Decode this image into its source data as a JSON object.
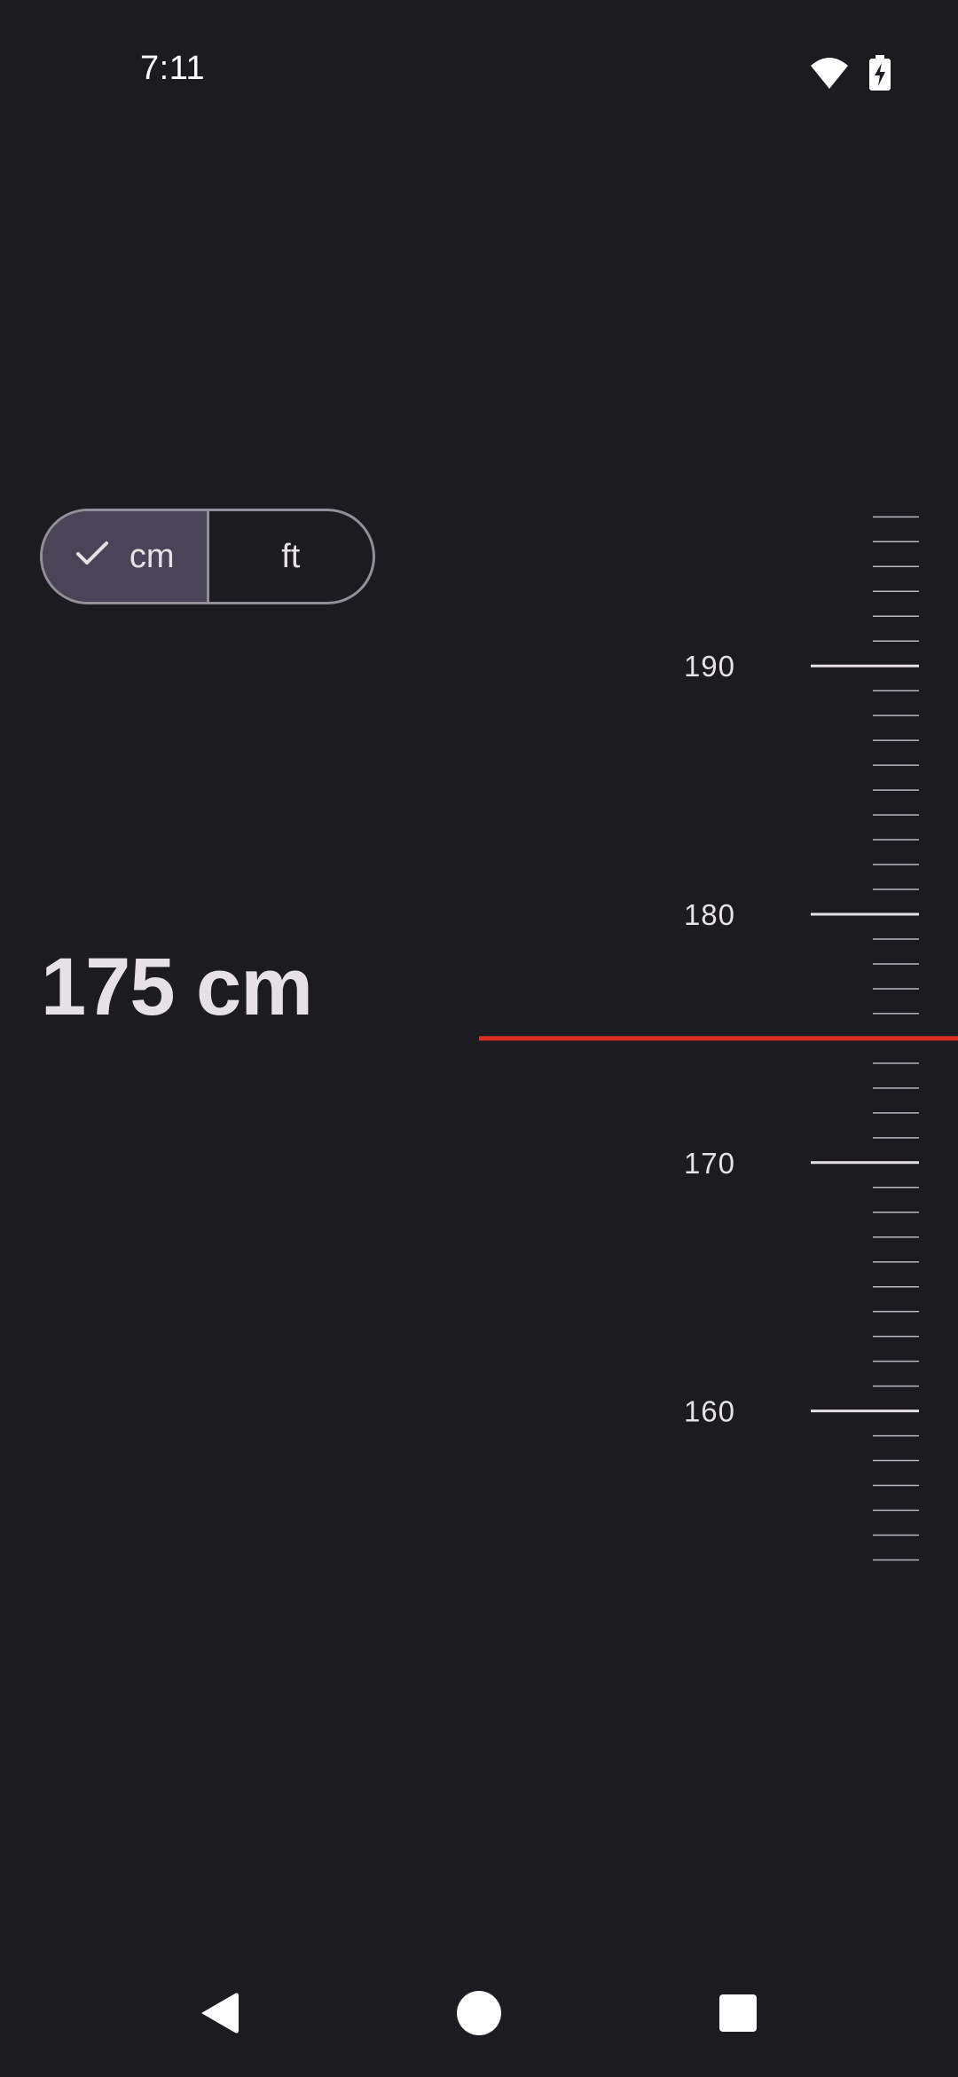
{
  "status_bar": {
    "time": "7:11",
    "icons": [
      "wifi-icon",
      "battery-charging-icon"
    ]
  },
  "unit_toggle": {
    "options": [
      {
        "label": "cm",
        "selected": true,
        "icon": "check-icon"
      },
      {
        "label": "ft",
        "selected": false
      }
    ]
  },
  "height_display": {
    "value": "175 cm"
  },
  "ruler": {
    "unit": "cm",
    "min": 154,
    "max": 196,
    "major_step": 10,
    "minor_step": 1,
    "labels": [
      "190",
      "180",
      "170",
      "160"
    ],
    "current_value": 175,
    "indicator_color": "#d93025"
  },
  "nav_bar": {
    "buttons": [
      "back-icon",
      "home-icon",
      "recents-icon"
    ]
  },
  "colors": {
    "background": "#1c1b20",
    "selected_segment": "#4a4458",
    "outline": "#938f99",
    "text": "#e6e1e6"
  }
}
